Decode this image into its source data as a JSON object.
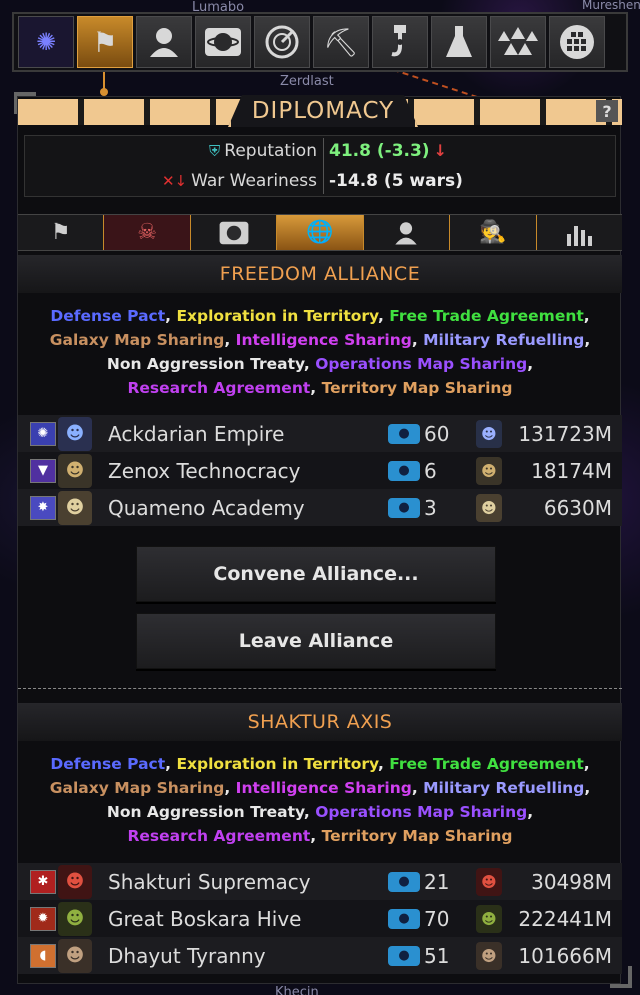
{
  "background": {
    "labels": [
      "Lumabo",
      "Mureshen",
      "Zerdlast",
      "Khecin"
    ]
  },
  "toolbar": {
    "buttons": [
      {
        "name": "empire-emblem",
        "icon": "alliance-emblem-icon"
      },
      {
        "name": "diplomacy",
        "icon": "crossed-flags-icon",
        "active": true
      },
      {
        "name": "leader",
        "icon": "person-icon"
      },
      {
        "name": "planets",
        "icon": "planet-icon"
      },
      {
        "name": "radar",
        "icon": "radar-icon"
      },
      {
        "name": "mining",
        "icon": "pickaxe-icon"
      },
      {
        "name": "crane",
        "icon": "hook-icon"
      },
      {
        "name": "research",
        "icon": "flask-icon"
      },
      {
        "name": "fleet",
        "icon": "triangles-icon"
      },
      {
        "name": "grid",
        "icon": "grid-icon"
      }
    ]
  },
  "panel": {
    "title": "DIPLOMACY",
    "help": "?",
    "reputation": {
      "label": "Reputation",
      "value": "41.8 (-3.3)",
      "value_color": "#7ef07e"
    },
    "war_weariness": {
      "label": "War Weariness",
      "value": "-14.8 (5 wars)"
    },
    "tabs": [
      {
        "icon": "crossed-flags-icon"
      },
      {
        "icon": "skull-icon"
      },
      {
        "icon": "planet-icon"
      },
      {
        "icon": "alliance-globe-icon",
        "active": true
      },
      {
        "icon": "person-icon"
      },
      {
        "icon": "spy-icon"
      },
      {
        "icon": "stats-icon"
      }
    ]
  },
  "alliances": [
    {
      "name": "FREEDOM ALLIANCE",
      "treaties": [
        "Defense Pact",
        "Exploration in Territory",
        "Free Trade Agreement",
        "Galaxy Map Sharing",
        "Intelligence Sharing",
        "Military Refuelling",
        "Non Aggression Treaty",
        "Operations Map Sharing",
        "Research Agreement",
        "Territory Map Sharing"
      ],
      "members": [
        {
          "name": "Ackdarian Empire",
          "planets": "60",
          "population": "131723M",
          "emblem_color": "#3a40b0"
        },
        {
          "name": "Zenox Technocracy",
          "planets": "6",
          "population": "18174M",
          "emblem_color": "#5030a0"
        },
        {
          "name": "Quameno Academy",
          "planets": "3",
          "population": "6630M",
          "emblem_color": "#4a4ac0"
        }
      ],
      "buttons": [
        "Convene Alliance...",
        "Leave Alliance"
      ]
    },
    {
      "name": "SHAKTUR AXIS",
      "treaties": [
        "Defense Pact",
        "Exploration in Territory",
        "Free Trade Agreement",
        "Galaxy Map Sharing",
        "Intelligence Sharing",
        "Military Refuelling",
        "Non Aggression Treaty",
        "Operations Map Sharing",
        "Research Agreement",
        "Territory Map Sharing"
      ],
      "members": [
        {
          "name": "Shakturi Supremacy",
          "planets": "21",
          "population": "30498M",
          "emblem_color": "#b02020"
        },
        {
          "name": "Great Boskara Hive",
          "planets": "70",
          "population": "222441M",
          "emblem_color": "#a02a1a"
        },
        {
          "name": "Dhayut Tyranny",
          "planets": "51",
          "population": "101666M",
          "emblem_color": "#d07030"
        }
      ]
    }
  ]
}
